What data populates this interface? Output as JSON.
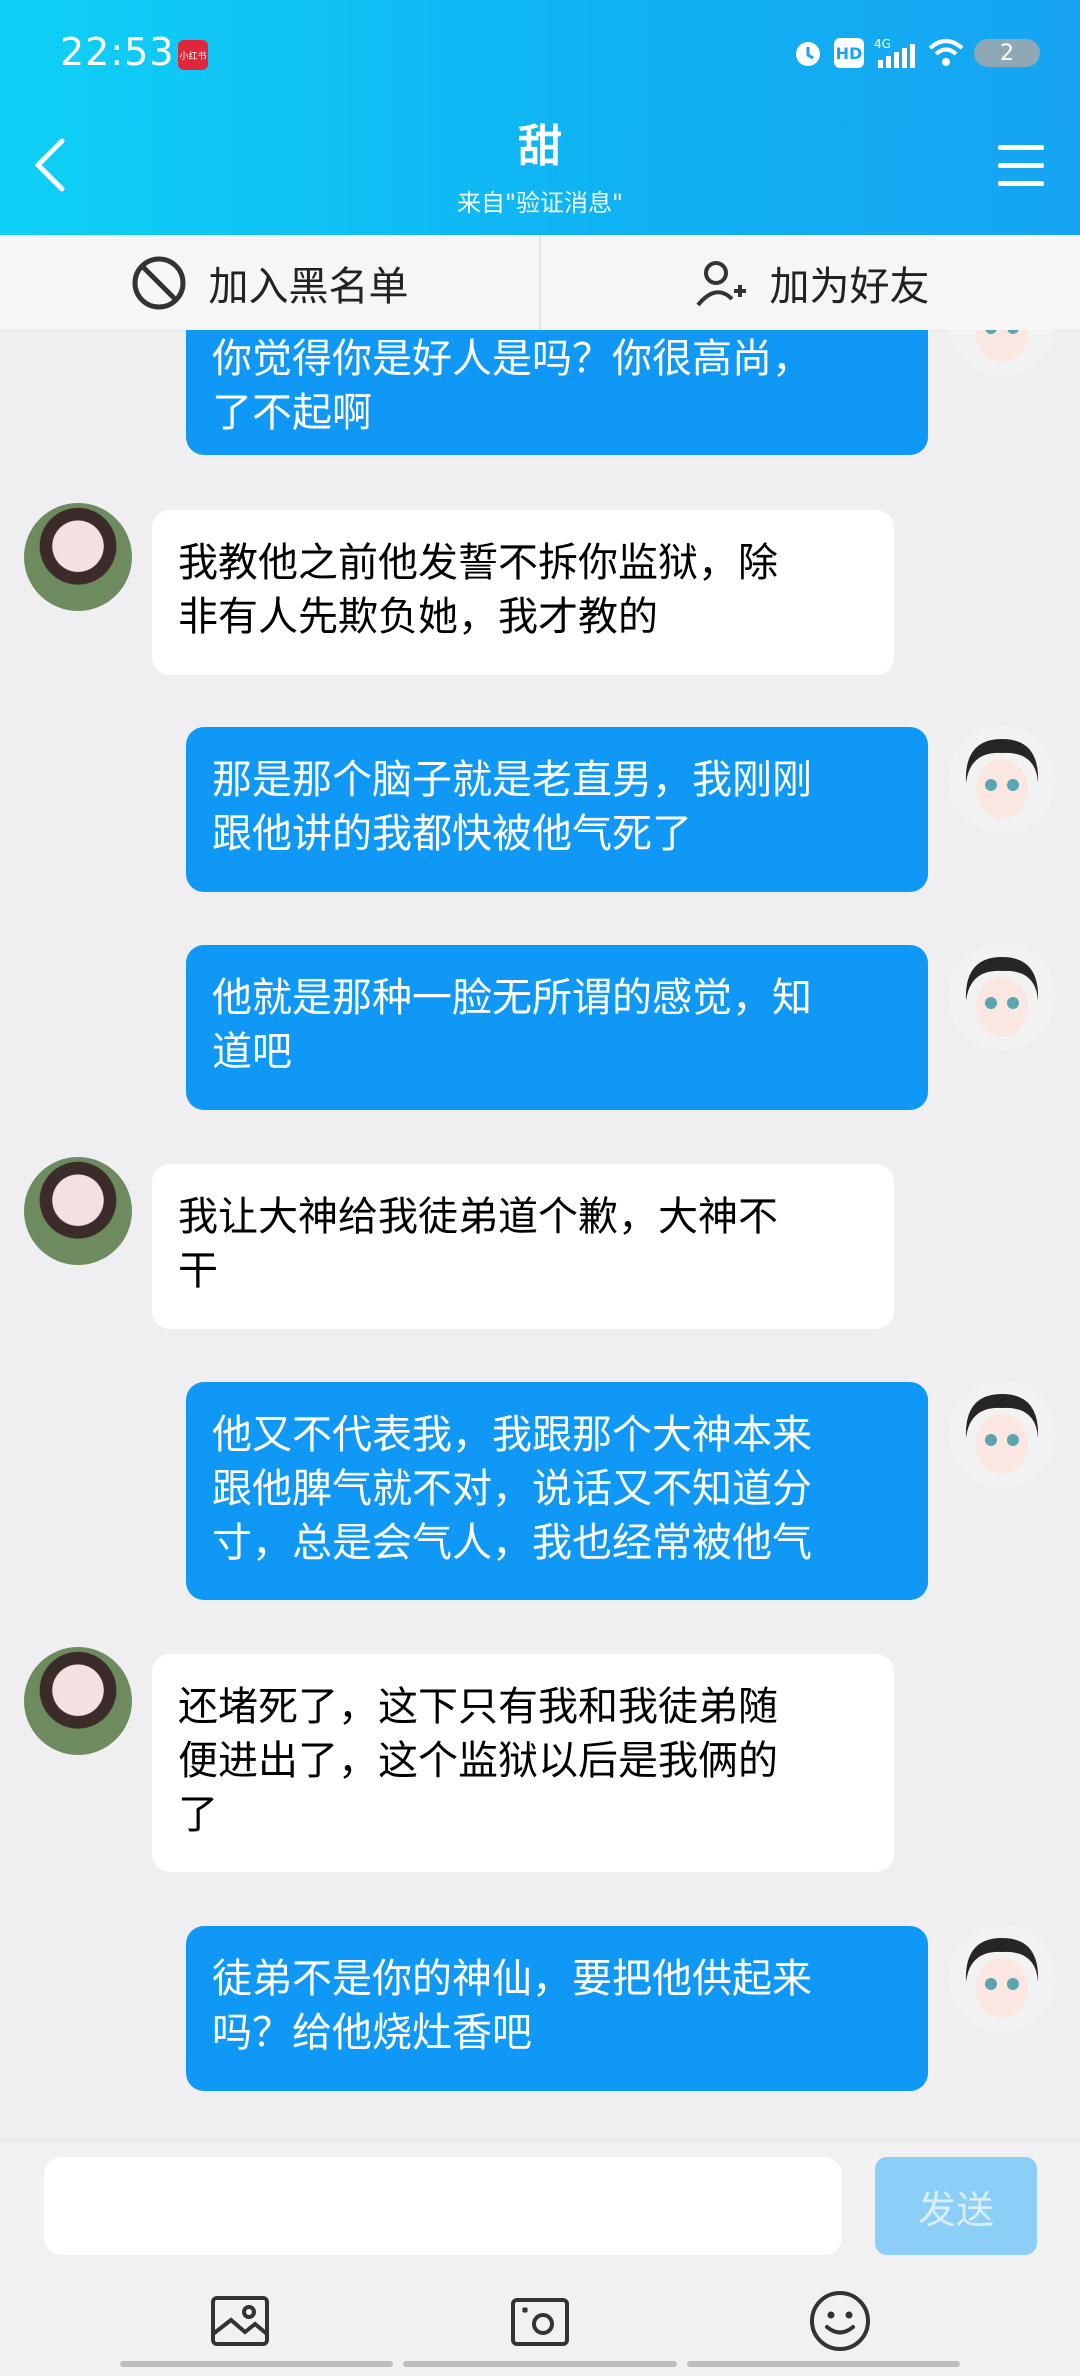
{
  "status_bar": {
    "time": "22:53",
    "app_badge": "小红书",
    "network": "4G",
    "hd": "HD",
    "battery": "2"
  },
  "header": {
    "back_icon": "chevron-left-icon",
    "title": "甜",
    "subtitle": "来自\"验证消息\"",
    "menu_icon": "menu-icon"
  },
  "actions": {
    "blacklist_label": "加入黑名单",
    "add_friend_label": "加为好友"
  },
  "messages": [
    {
      "side": "me",
      "lines": [
        "你觉得你是好人是吗？你很高尚，",
        "了不起啊"
      ]
    },
    {
      "side": "other",
      "lines": [
        "我教他之前他发誓不拆你监狱，除",
        "非有人先欺负她，我才教的"
      ]
    },
    {
      "side": "me",
      "lines": [
        "那是那个脑子就是老直男，我刚刚",
        "跟他讲的我都快被他气死了"
      ]
    },
    {
      "side": "me",
      "lines": [
        "他就是那种一脸无所谓的感觉，知",
        "道吧"
      ]
    },
    {
      "side": "other",
      "lines": [
        "我让大神给我徒弟道个歉，大神不",
        "干"
      ]
    },
    {
      "side": "me",
      "lines": [
        "他又不代表我，我跟那个大神本来",
        "跟他脾气就不对，说话又不知道分",
        "寸，总是会气人，我也经常被他气"
      ]
    },
    {
      "side": "other",
      "lines": [
        "还堵死了，这下只有我和我徒弟随",
        "便进出了，这个监狱以后是我俩的",
        "了"
      ]
    },
    {
      "side": "me",
      "lines": [
        "徒弟不是你的神仙，要把他供起来",
        "吗？给他烧灶香吧"
      ]
    }
  ],
  "input": {
    "placeholder": "",
    "send_label": "发送"
  },
  "colors": {
    "accent": "#0f98f6",
    "header_start": "#0fd1f6",
    "header_end": "#16a4f2"
  }
}
